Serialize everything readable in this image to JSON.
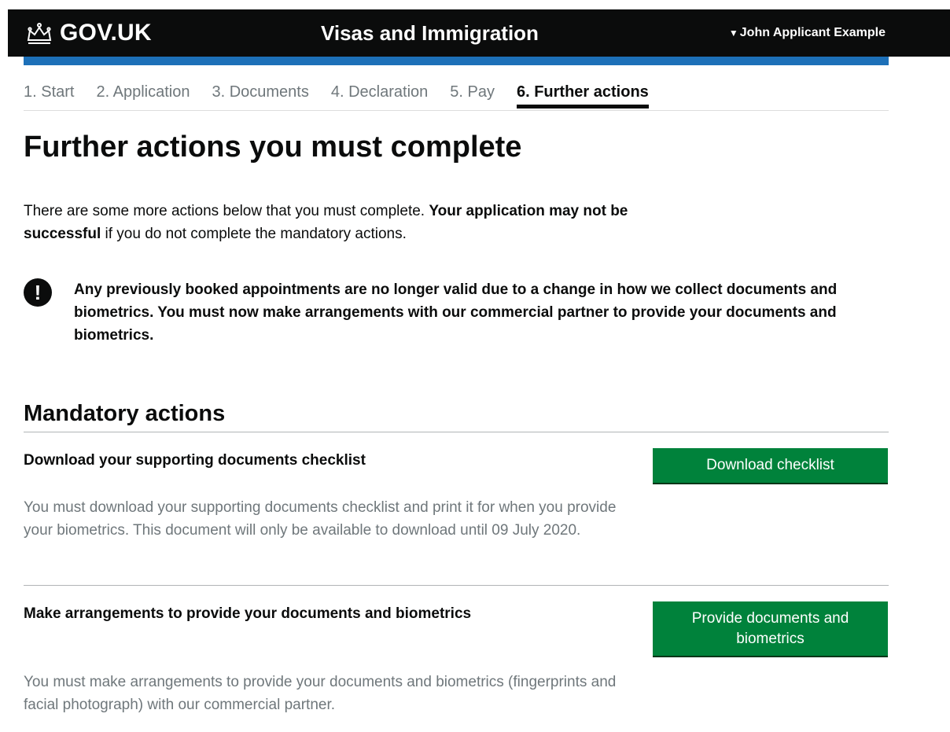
{
  "header": {
    "logo_text": "GOV.UK",
    "service_name": "Visas and Immigration",
    "user_name": "John Applicant Example",
    "user_caret_icon": "caret-down-icon",
    "logo_icon": "crown-icon"
  },
  "steps": [
    {
      "label": "1. Start",
      "active": false
    },
    {
      "label": "2. Application",
      "active": false
    },
    {
      "label": "3. Documents",
      "active": false
    },
    {
      "label": "4. Declaration",
      "active": false
    },
    {
      "label": "5. Pay",
      "active": false
    },
    {
      "label": "6. Further actions",
      "active": true
    }
  ],
  "page": {
    "title": "Further actions you must complete",
    "intro_text_1": "There are some more actions below that you must complete. ",
    "intro_bold": "Your application may not be successful",
    "intro_text_2": " if you do not complete the mandatory actions.",
    "warning_icon": "exclamation-icon",
    "warning_text": "Any previously booked appointments are no longer valid due to a change in how we collect documents and biometrics. You must now make arrangements with our commercial partner to provide your documents and biometrics."
  },
  "mandatory": {
    "heading": "Mandatory actions",
    "actions": [
      {
        "title": "Download your supporting documents checklist",
        "description": "You must download your supporting documents checklist and print it for when you provide your biometrics. This document will only be available to download until 09 July 2020.",
        "button": "Download checklist"
      },
      {
        "title": "Make arrangements to provide your documents and biometrics",
        "description": "You must make arrangements to provide your documents and biometrics (fingerprints and facial photograph) with our commercial partner.",
        "button": "Provide documents and biometrics"
      }
    ]
  },
  "colors": {
    "header_bg": "#0b0c0c",
    "brand_bar": "#1d70b8",
    "button_green": "#00823b",
    "muted_text": "#6f777b"
  }
}
